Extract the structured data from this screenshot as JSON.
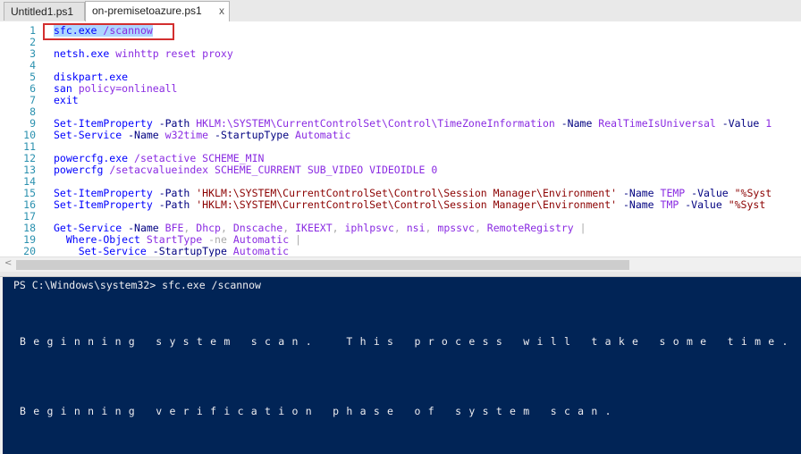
{
  "tabs": [
    {
      "label": "Untitled1.ps1",
      "active": false
    },
    {
      "label": "on-premisetoazure.ps1",
      "active": true,
      "close": "x"
    }
  ],
  "editor": {
    "lines": [
      {
        "n": "1",
        "tokens": [
          {
            "t": "sfc.exe",
            "c": "cmd sel"
          },
          {
            "t": " ",
            "c": "sel"
          },
          {
            "t": "/scannow",
            "c": "arg sel"
          }
        ]
      },
      {
        "n": "2",
        "tokens": []
      },
      {
        "n": "3",
        "tokens": [
          {
            "t": "netsh.exe",
            "c": "cmd"
          },
          {
            "t": " winhttp reset proxy",
            "c": "arg"
          }
        ]
      },
      {
        "n": "4",
        "tokens": []
      },
      {
        "n": "5",
        "tokens": [
          {
            "t": "diskpart.exe",
            "c": "cmd"
          }
        ]
      },
      {
        "n": "6",
        "tokens": [
          {
            "t": "san",
            "c": "cmd"
          },
          {
            "t": " policy=onlineall",
            "c": "arg"
          }
        ]
      },
      {
        "n": "7",
        "tokens": [
          {
            "t": "exit",
            "c": "cmd"
          }
        ]
      },
      {
        "n": "8",
        "tokens": []
      },
      {
        "n": "9",
        "tokens": [
          {
            "t": "Set-ItemProperty",
            "c": "cmd"
          },
          {
            "t": " -Path",
            "c": "param"
          },
          {
            "t": " HKLM:\\SYSTEM\\CurrentControlSet\\Control\\TimeZoneInformation",
            "c": "arg"
          },
          {
            "t": " -Name",
            "c": "param"
          },
          {
            "t": " RealTimeIsUniversal",
            "c": "arg"
          },
          {
            "t": " -Value",
            "c": "param"
          },
          {
            "t": " 1",
            "c": "arg"
          }
        ]
      },
      {
        "n": "10",
        "tokens": [
          {
            "t": "Set-Service",
            "c": "cmd"
          },
          {
            "t": " -Name",
            "c": "param"
          },
          {
            "t": " w32time",
            "c": "arg"
          },
          {
            "t": " -StartupType",
            "c": "param"
          },
          {
            "t": " Automatic",
            "c": "arg"
          }
        ]
      },
      {
        "n": "11",
        "tokens": []
      },
      {
        "n": "12",
        "tokens": [
          {
            "t": "powercfg.exe",
            "c": "cmd"
          },
          {
            "t": " /setactive SCHEME_MIN",
            "c": "arg"
          }
        ]
      },
      {
        "n": "13",
        "tokens": [
          {
            "t": "powercfg",
            "c": "cmd"
          },
          {
            "t": " /setacvalueindex SCHEME_CURRENT SUB_VIDEO VIDEOIDLE 0",
            "c": "arg"
          }
        ]
      },
      {
        "n": "14",
        "tokens": []
      },
      {
        "n": "15",
        "tokens": [
          {
            "t": "Set-ItemProperty",
            "c": "cmd"
          },
          {
            "t": " -Path",
            "c": "param"
          },
          {
            "t": " 'HKLM:\\SYSTEM\\CurrentControlSet\\Control\\Session Manager\\Environment'",
            "c": "str"
          },
          {
            "t": " -Name",
            "c": "param"
          },
          {
            "t": " TEMP",
            "c": "arg"
          },
          {
            "t": " -Value",
            "c": "param"
          },
          {
            "t": " \"%Syst",
            "c": "str"
          }
        ]
      },
      {
        "n": "16",
        "tokens": [
          {
            "t": "Set-ItemProperty",
            "c": "cmd"
          },
          {
            "t": " -Path",
            "c": "param"
          },
          {
            "t": " 'HKLM:\\SYSTEM\\CurrentControlSet\\Control\\Session Manager\\Environment'",
            "c": "str"
          },
          {
            "t": " -Name",
            "c": "param"
          },
          {
            "t": " TMP",
            "c": "arg"
          },
          {
            "t": " -Value",
            "c": "param"
          },
          {
            "t": " \"%Syst",
            "c": "str"
          }
        ]
      },
      {
        "n": "17",
        "tokens": []
      },
      {
        "n": "18",
        "tokens": [
          {
            "t": "Get-Service",
            "c": "cmd"
          },
          {
            "t": " -Name",
            "c": "param"
          },
          {
            "t": " BFE",
            "c": "arg"
          },
          {
            "t": ",",
            "c": "op"
          },
          {
            "t": " Dhcp",
            "c": "arg"
          },
          {
            "t": ",",
            "c": "op"
          },
          {
            "t": " Dnscache",
            "c": "arg"
          },
          {
            "t": ",",
            "c": "op"
          },
          {
            "t": " IKEEXT",
            "c": "arg"
          },
          {
            "t": ",",
            "c": "op"
          },
          {
            "t": " iphlpsvc",
            "c": "arg"
          },
          {
            "t": ",",
            "c": "op"
          },
          {
            "t": " nsi",
            "c": "arg"
          },
          {
            "t": ",",
            "c": "op"
          },
          {
            "t": " mpssvc",
            "c": "arg"
          },
          {
            "t": ",",
            "c": "op"
          },
          {
            "t": " RemoteRegistry",
            "c": "arg"
          },
          {
            "t": " |",
            "c": "op"
          }
        ]
      },
      {
        "n": "19",
        "tokens": [
          {
            "t": "  Where-Object",
            "c": "cmd"
          },
          {
            "t": " StartType",
            "c": "arg"
          },
          {
            "t": " -ne",
            "c": "op"
          },
          {
            "t": " Automatic",
            "c": "arg"
          },
          {
            "t": " |",
            "c": "op"
          }
        ]
      },
      {
        "n": "20",
        "tokens": [
          {
            "t": "    Set-Service",
            "c": "cmd"
          },
          {
            "t": " -StartupType",
            "c": "param"
          },
          {
            "t": " Automatic",
            "c": "arg"
          }
        ]
      }
    ]
  },
  "scrollbar": {
    "left_arrow": "<"
  },
  "console": {
    "prompt": "PS C:\\Windows\\system32> sfc.exe /scannow",
    "output": [
      "Beginning system scan.  This process will take some time.",
      "Beginning verification phase of system scan."
    ]
  },
  "colors": {
    "console_bg": "#012456",
    "selection": "#add6ff",
    "highlight_box": "#d32f2f"
  }
}
